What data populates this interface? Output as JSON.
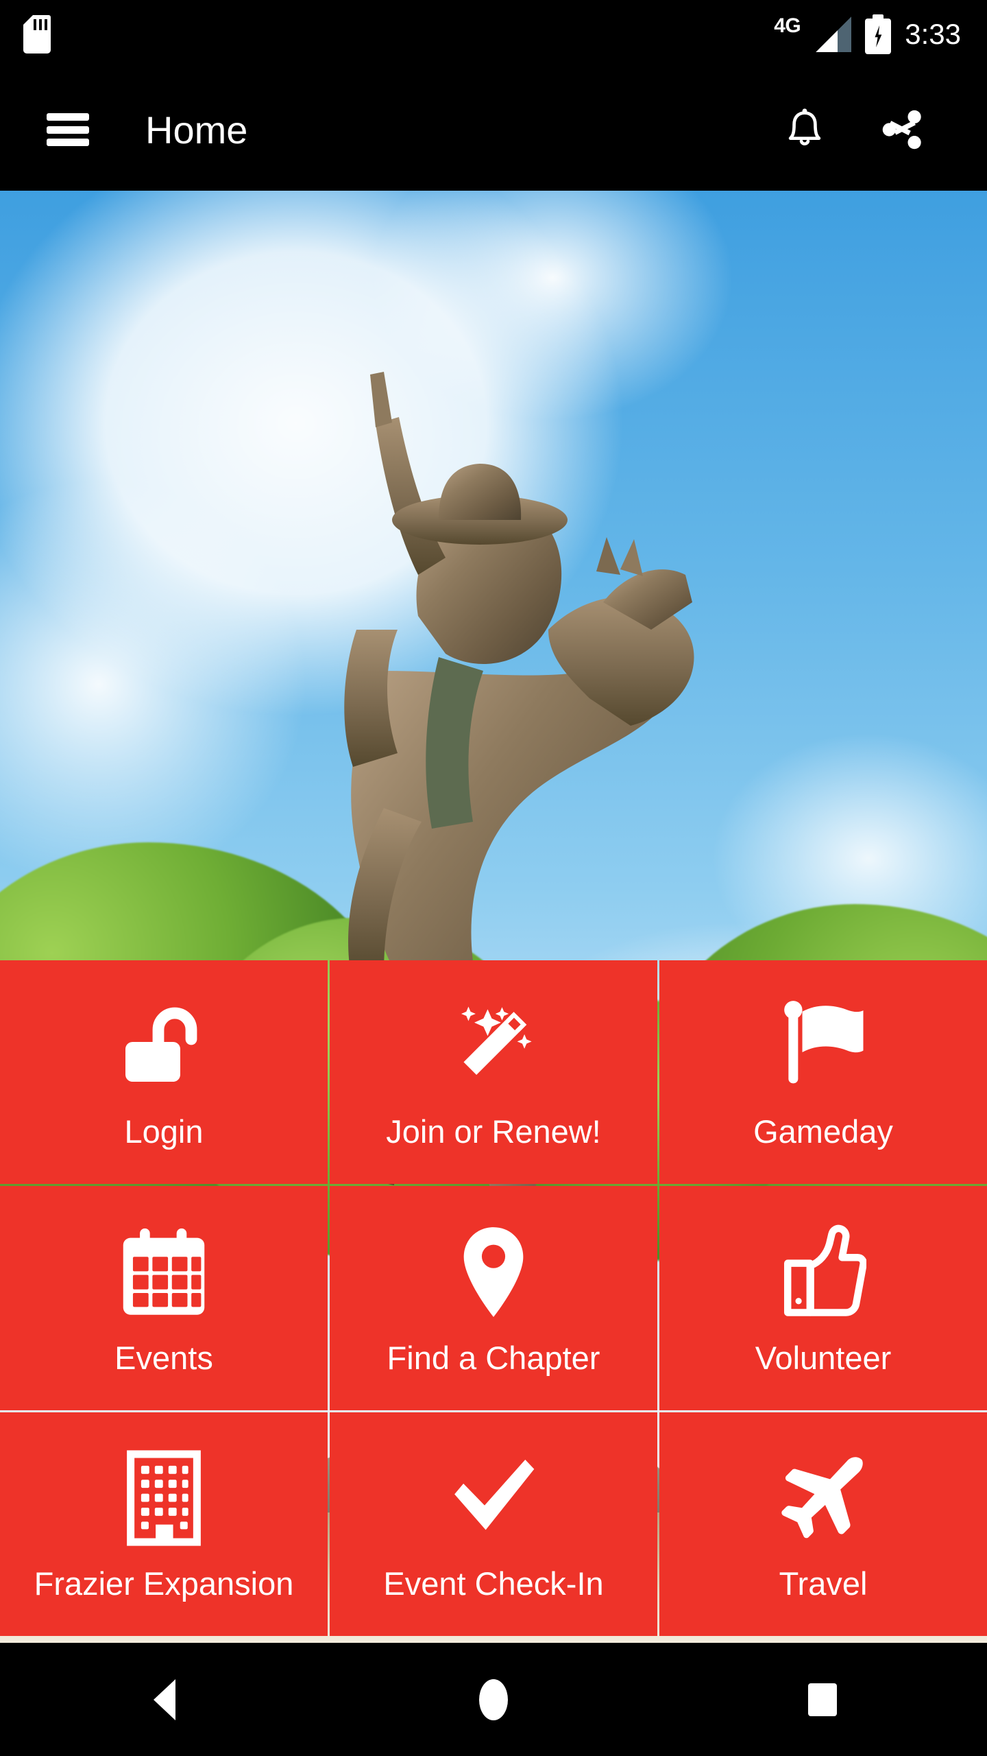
{
  "status_bar": {
    "sdcard_icon": "sd-card-icon",
    "network_type": "4G",
    "signal_icon": "signal-bars-icon",
    "battery_icon": "battery-charging-icon",
    "time": "3:33"
  },
  "app_bar": {
    "menu_icon": "hamburger-menu-icon",
    "title": "Home",
    "notifications_icon": "bell-icon",
    "share_icon": "share-icon"
  },
  "hero": {
    "alt": "Bronze statue of a cowboy riding a rearing horse under a blue sky with clouds and green trees"
  },
  "theme": {
    "tile_color": "#ee3329",
    "bar_color": "#000000",
    "text_color": "#ffffff"
  },
  "grid": {
    "tiles": [
      {
        "label": "Login",
        "icon": "unlock-icon"
      },
      {
        "label": "Join or Renew!",
        "icon": "magic-wand-icon"
      },
      {
        "label": "Gameday",
        "icon": "flag-icon"
      },
      {
        "label": "Events",
        "icon": "calendar-icon"
      },
      {
        "label": "Find a Chapter",
        "icon": "map-pin-icon"
      },
      {
        "label": "Volunteer",
        "icon": "thumbs-up-icon"
      },
      {
        "label": "Frazier Expansion",
        "icon": "building-icon"
      },
      {
        "label": "Event Check-In",
        "icon": "check-icon"
      },
      {
        "label": "Travel",
        "icon": "airplane-icon"
      }
    ]
  },
  "nav_bar": {
    "back_label": "Back",
    "home_label": "Home",
    "recents_label": "Recents"
  }
}
